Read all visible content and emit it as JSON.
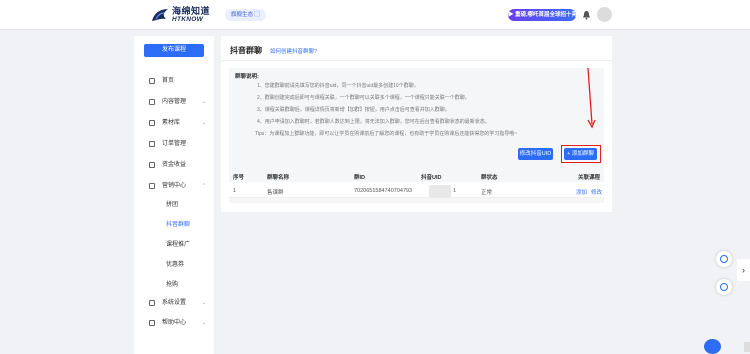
{
  "header": {
    "brand_cn": "海绵知道",
    "brand_en": "HTKNOW",
    "version_tag": "旗舰生态 ▢",
    "promo_label": "▶ 重磅,哪吒首届全球招十亮",
    "icons": [
      "logo-icon",
      "bell-icon",
      "avatar"
    ]
  },
  "sidebar": {
    "publish_label": "发布课程",
    "items": [
      {
        "label": "首页",
        "icon": "home-icon",
        "expandable": false
      },
      {
        "label": "内容管理",
        "icon": "content-icon",
        "expandable": true
      },
      {
        "label": "素材库",
        "icon": "library-icon",
        "expandable": true
      },
      {
        "label": "订单管理",
        "icon": "order-icon",
        "expandable": false
      },
      {
        "label": "资金收益",
        "icon": "money-icon",
        "expandable": false
      },
      {
        "label": "营销中心",
        "icon": "marketing-icon",
        "expandable": true
      },
      {
        "label": "拼团",
        "sub": true
      },
      {
        "label": "抖音群聊",
        "sub": true,
        "active": true
      },
      {
        "label": "课程推广",
        "sub": true
      },
      {
        "label": "优惠券",
        "sub": true
      },
      {
        "label": "抢购",
        "sub": true
      },
      {
        "label": "系统设置",
        "icon": "settings-icon",
        "expandable": true
      },
      {
        "label": "帮助中心",
        "icon": "help-icon",
        "expandable": true
      }
    ]
  },
  "main": {
    "title": "抖音群聊",
    "how_link": "如何创建抖音群聊?",
    "notice": {
      "title": "群聊说明:",
      "lines": [
        "1、您建群聊前请先填写您的抖音uid，同一个抖音uid最多创建10个群聊。",
        "2、群聊创建完成后即可与课程关联，一个群聊可以关联多个课程，一个课程只能关联一个群聊。",
        "3、课程关联群聊后，课程详情页将新增【加群】按钮，用户点击后可查看并加入群聊。",
        "4、用户申请加入群聊时，若群聊人数达到上限，将无法加入群聊，您可在后台查看群聊状态的最新状态。",
        "Tips：为课程加上群聊功能，即可以让学员在购课前后了解您的课程，也有助于学员在购课后还能获得您的学习指导哦~"
      ]
    },
    "buttons": {
      "edit_uid": "修改抖音UID",
      "add_group": "+ 添加群聊"
    },
    "table": {
      "headers": [
        "序号",
        "群聊名称",
        "群ID",
        "抖音UID",
        "群状态",
        "关联课程"
      ],
      "rows": [
        {
          "index": "1",
          "name": "售课群",
          "group_id": "7020651584740704793",
          "uid": "1",
          "status": "正常",
          "action_add": "添加",
          "action_edit": "修改"
        }
      ]
    }
  },
  "floating": {
    "right_tab": "›"
  }
}
